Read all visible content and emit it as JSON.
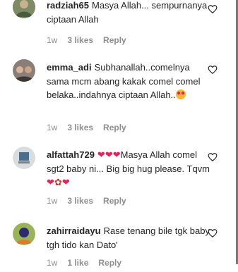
{
  "comments": [
    {
      "username": "radziah65",
      "text": "Masya Allah... sempurnanya ciptaan Allah",
      "time": "1w",
      "likes": "3 likes",
      "reply": "Reply"
    },
    {
      "username": "emma_adi",
      "text": "Subhanallah..comelnya sama mcm abang kakak comel comel belaka..indahnya ciptaan Allah..",
      "emoji": "heart-eyes",
      "time": "1w",
      "likes": "3 likes",
      "reply": "Reply"
    },
    {
      "username": "alfattah729",
      "text_pre": "Masya Allah comel sgt2 baby ni... Big big hug please. Tqvm",
      "emoji_prefix": [
        "heart",
        "heart",
        "heart"
      ],
      "emoji_suffix": [
        "heart",
        "rose",
        "heart"
      ],
      "time": "1w",
      "likes": "3 likes",
      "reply": "Reply"
    },
    {
      "username": "zahirraidayu",
      "text": "Rase tenang bile tgk baby tgh tido kan Dato'",
      "time": "1w",
      "likes": "1 like",
      "reply": "Reply"
    }
  ]
}
